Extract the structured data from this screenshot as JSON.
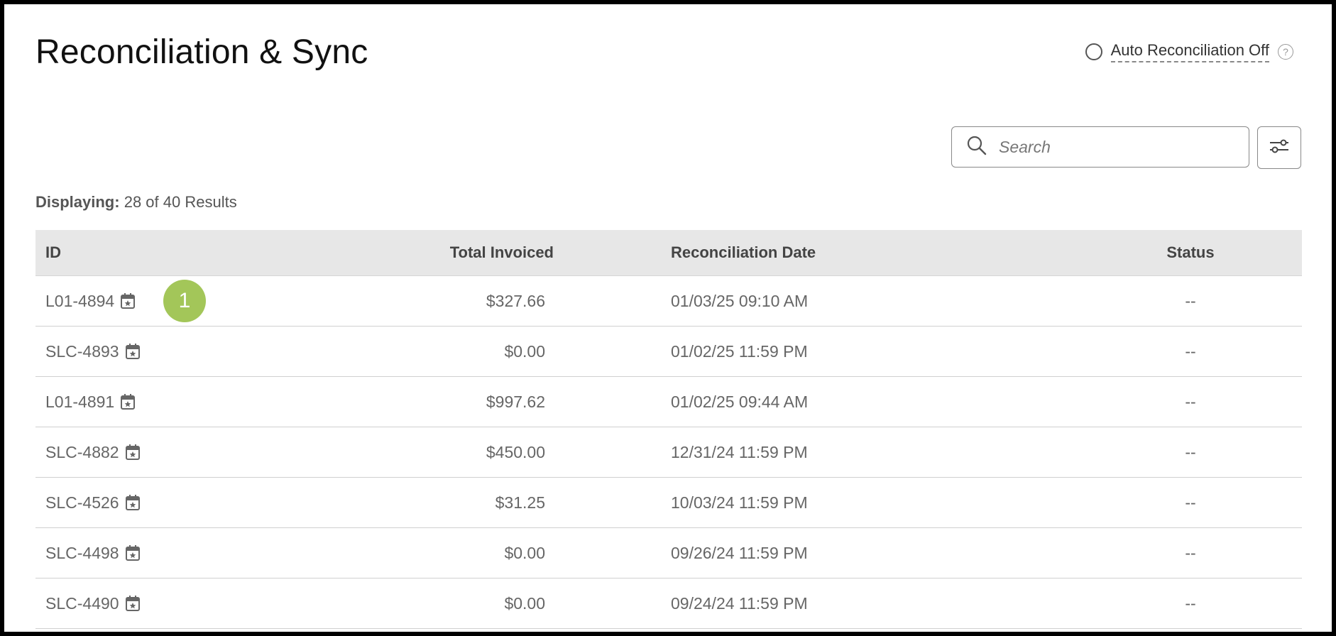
{
  "page": {
    "title": "Reconciliation & Sync"
  },
  "auto_reconciliation": {
    "label": "Auto Reconciliation Off",
    "help": "?"
  },
  "search": {
    "placeholder": "Search",
    "value": ""
  },
  "results": {
    "label": "Displaying:",
    "text": "28 of 40 Results"
  },
  "table": {
    "headers": {
      "id": "ID",
      "total": "Total Invoiced",
      "date": "Reconciliation Date",
      "status": "Status"
    },
    "rows": [
      {
        "id": "L01-4894",
        "total": "$327.66",
        "date": "01/03/25 09:10 AM",
        "status": "--",
        "badge": "1"
      },
      {
        "id": "SLC-4893",
        "total": "$0.00",
        "date": "01/02/25 11:59 PM",
        "status": "--"
      },
      {
        "id": "L01-4891",
        "total": "$997.62",
        "date": "01/02/25 09:44 AM",
        "status": "--"
      },
      {
        "id": "SLC-4882",
        "total": "$450.00",
        "date": "12/31/24 11:59 PM",
        "status": "--"
      },
      {
        "id": "SLC-4526",
        "total": "$31.25",
        "date": "10/03/24 11:59 PM",
        "status": "--"
      },
      {
        "id": "SLC-4498",
        "total": "$0.00",
        "date": "09/26/24 11:59 PM",
        "status": "--"
      },
      {
        "id": "SLC-4490",
        "total": "$0.00",
        "date": "09/24/24 11:59 PM",
        "status": "--"
      }
    ]
  },
  "colors": {
    "badge": "#a3c659",
    "header_bg": "#e7e7e7",
    "text_muted": "#666666"
  },
  "icons": {
    "search": "search-icon",
    "filter": "sliders-icon",
    "calendar": "calendar-star-icon",
    "help": "question-circle-icon"
  }
}
